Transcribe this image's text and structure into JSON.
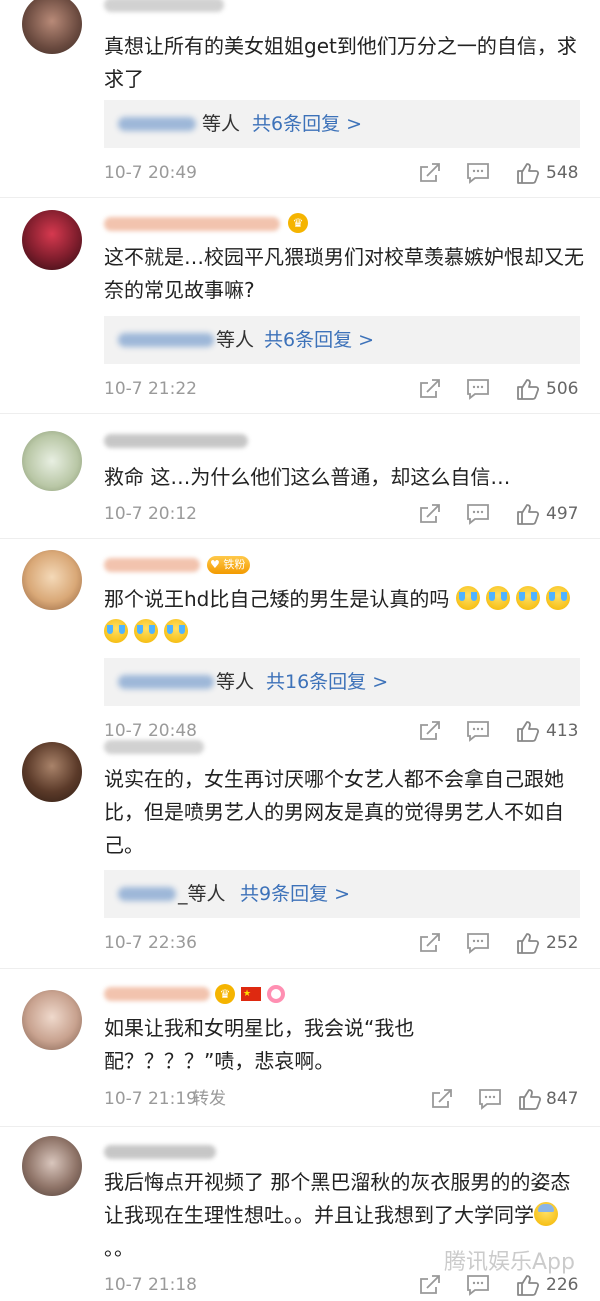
{
  "colors": {
    "link_blue": "#3d72b9",
    "meta_gray": "#9a9a9a",
    "reply_bg": "#f2f2f2"
  },
  "comments": [
    {
      "text": "真想让所有的美女姐姐get到他们万分之一的自信，求求了",
      "reply": {
        "suffix": "等人",
        "count": "共6条回复 >"
      },
      "time": "10-7 20:49",
      "likes": "548"
    },
    {
      "text": "这不就是…校园平凡猥琐男们对校草羡慕嫉妒恨却又无奈的常见故事嘛?",
      "reply": {
        "suffix": "等人",
        "count": "共6条回复 >"
      },
      "time": "10-7 21:22",
      "likes": "506"
    },
    {
      "text": "救命 这…为什么他们这么普通，却这么自信…",
      "time": "10-7 20:12",
      "likes": "497"
    },
    {
      "text": "那个说王hd比自己矮的男生是认真的吗",
      "fan_badge": "铁粉",
      "reply": {
        "suffix": "等人",
        "count": "共16条回复 >"
      },
      "time": "10-7 20:48",
      "likes": "413"
    },
    {
      "text": "说实在的，女生再讨厌哪个女艺人都不会拿自己跟她比，但是喷男艺人的男网友是真的觉得男艺人不如自己。",
      "reply": {
        "suffix": "_等人",
        "count": "共9条回复 >"
      },
      "time": "10-7 22:36",
      "likes": "252"
    },
    {
      "text": "如果让我和女明星比，我会说“我也配？？？？”啧，悲哀啊。",
      "time": "10-7 21:19",
      "repost": "转发",
      "likes": "847"
    },
    {
      "text": "我后悔点开视频了 那个黑巴溜秋的灰衣服男的的姿态让我现在生理性想吐。。并且让我想到了大学同学",
      "text_tail": "。。",
      "time": "10-7 21:18",
      "likes": "226"
    }
  ],
  "watermark": "腾讯娱乐App"
}
